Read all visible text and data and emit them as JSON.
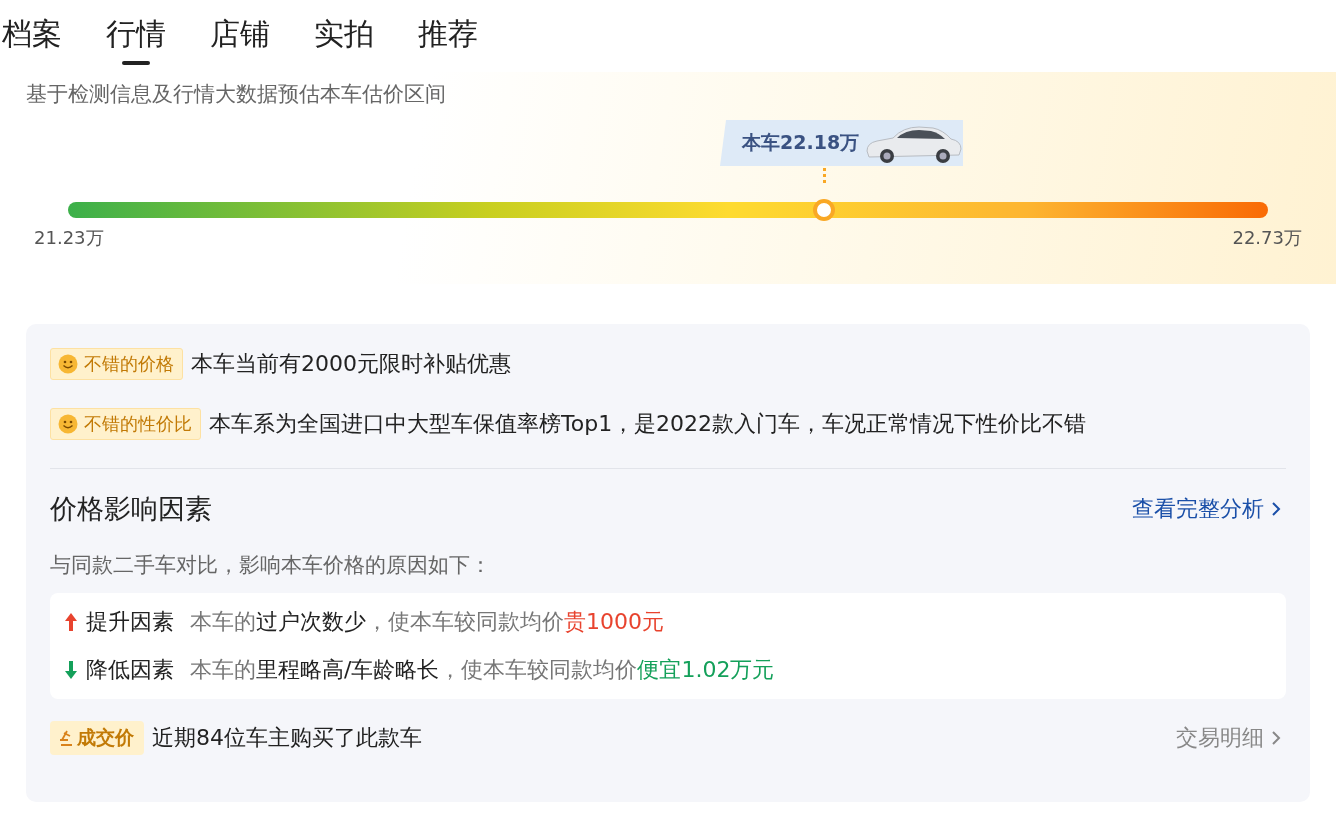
{
  "tabs": [
    {
      "label": "档案",
      "selected": false
    },
    {
      "label": "行情",
      "selected": true
    },
    {
      "label": "店铺",
      "selected": false
    },
    {
      "label": "实拍",
      "selected": false
    },
    {
      "label": "推荐",
      "selected": false
    }
  ],
  "estimate": {
    "description": "基于检测信息及行情大数据预估本车估价区间",
    "marker_label": "本车22.18万",
    "level": 0.63,
    "min_label": "21.23万",
    "max_label": "22.73万"
  },
  "highlights": [
    {
      "tag": "不错的价格",
      "text": "本车当前有2000元限时补贴优惠"
    },
    {
      "tag": "不错的性价比",
      "text": "本车系为全国进口中大型车保值率榜Top1，是2022款入门车，车况正常情况下性价比不错"
    }
  ],
  "factors": {
    "title": "价格影响因素",
    "link": "查看完整分析",
    "intro": "与同款二手车对比，影响本车价格的原因如下：",
    "items": [
      {
        "kind": "up",
        "label": "提升因素",
        "subject": "本车的",
        "detail": "过户次数少",
        "comparison": "，使本车较同款均价",
        "amount": "贵1000元"
      },
      {
        "kind": "down",
        "label": "降低因素",
        "subject": "本车的",
        "detail": "里程略高/车龄略长",
        "comparison": "，使本车较同款均价",
        "amount": "便宜1.02万元"
      }
    ]
  },
  "deals": {
    "tag": "成交价",
    "text": "近期84位车主购买了此款车",
    "link": "交易明细"
  }
}
